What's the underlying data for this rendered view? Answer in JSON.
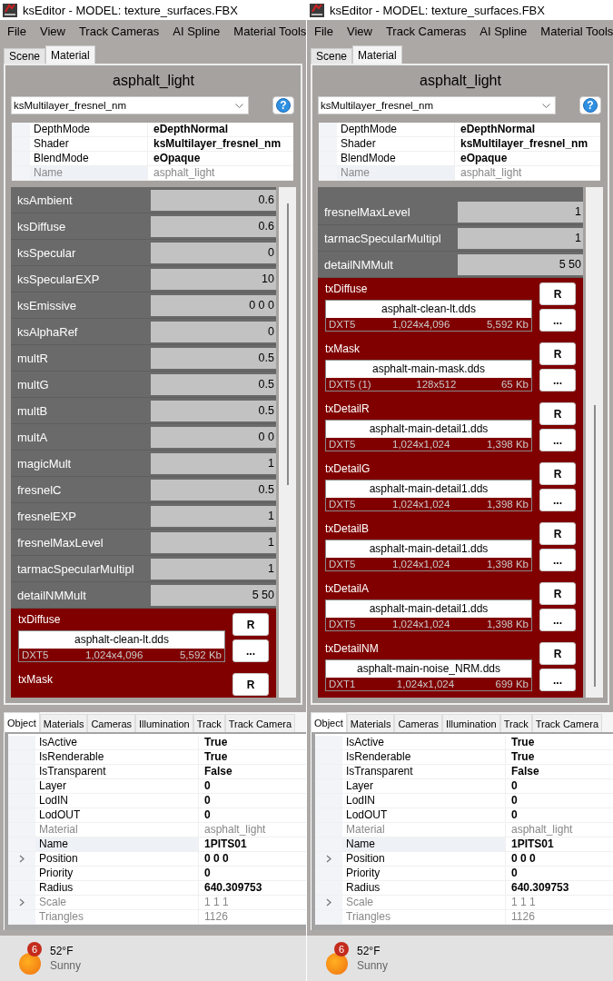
{
  "panels": [
    {
      "window": {
        "title": "ksEditor - MODEL: texture_surfaces.FBX"
      },
      "menu": [
        "File",
        "View",
        "Track Cameras",
        "AI Spline",
        "Material Tools"
      ],
      "tabs": [
        {
          "label": "Scene",
          "selected": false
        },
        {
          "label": "Material",
          "selected": true
        }
      ],
      "material": {
        "name": "asphalt_light",
        "shader_dropdown": {
          "value": "ksMultilayer_fresnel_nm"
        },
        "help_button": {
          "label": "?"
        },
        "properties": [
          {
            "label": "DepthMode",
            "value": "eDepthNormal",
            "readonly": false,
            "selected": false
          },
          {
            "label": "Shader",
            "value": "ksMultilayer_fresnel_nm",
            "readonly": false,
            "selected": false
          },
          {
            "label": "BlendMode",
            "value": "eOpaque",
            "readonly": false,
            "selected": false
          },
          {
            "label": "Name",
            "value": "asphalt_light",
            "readonly": true,
            "selected": true
          }
        ],
        "parameters": [
          {
            "label": "ksAmbient",
            "value": "0.6"
          },
          {
            "label": "ksDiffuse",
            "value": "0.6"
          },
          {
            "label": "ksSpecular",
            "value": "0"
          },
          {
            "label": "ksSpecularEXP",
            "value": "10"
          },
          {
            "label": "ksEmissive",
            "value": "0 0 0"
          },
          {
            "label": "ksAlphaRef",
            "value": "0"
          },
          {
            "label": "multR",
            "value": "0.5"
          },
          {
            "label": "multG",
            "value": "0.5"
          },
          {
            "label": "multB",
            "value": "0.5"
          },
          {
            "label": "multA",
            "value": "0 0"
          },
          {
            "label": "magicMult",
            "value": "1"
          },
          {
            "label": "fresnelC",
            "value": "0.5"
          },
          {
            "label": "fresnelEXP",
            "value": "1"
          },
          {
            "label": "fresnelMaxLevel",
            "value": "1"
          },
          {
            "label": "tarmacSpecularMultipl",
            "value": "1"
          },
          {
            "label": "detailNMMult",
            "value": "5 50"
          }
        ],
        "textures": [
          {
            "label": "txDiffuse",
            "file": "asphalt-clean-lt.dds",
            "format": "DXT5",
            "dimensions": "1,024x4,096",
            "filesize": "5,592 Kb",
            "buttons": [
              "R",
              "..."
            ]
          },
          {
            "label": "txMask",
            "buttons": [
              "R"
            ]
          }
        ]
      },
      "object_tabs": [
        {
          "label": "Object",
          "selected": true
        },
        {
          "label": "Materials",
          "selected": false
        },
        {
          "label": "Cameras",
          "selected": false
        },
        {
          "label": "Illumination",
          "selected": false
        },
        {
          "label": "Track",
          "selected": false
        },
        {
          "label": "Track Camera",
          "selected": false
        }
      ],
      "object_properties": [
        {
          "label": "IsActive",
          "value": "True",
          "readonly": false,
          "expandable": false,
          "selected": false
        },
        {
          "label": "IsRenderable",
          "value": "True",
          "readonly": false,
          "expandable": false,
          "selected": false
        },
        {
          "label": "IsTransparent",
          "value": "False",
          "readonly": false,
          "expandable": false,
          "selected": false
        },
        {
          "label": "Layer",
          "value": "0",
          "readonly": false,
          "expandable": false,
          "selected": false
        },
        {
          "label": "LodIN",
          "value": "0",
          "readonly": false,
          "expandable": false,
          "selected": false
        },
        {
          "label": "LodOUT",
          "value": "0",
          "readonly": false,
          "expandable": false,
          "selected": false
        },
        {
          "label": "Material",
          "value": "asphalt_light",
          "readonly": true,
          "expandable": false,
          "selected": false
        },
        {
          "label": "Name",
          "value": "1PITS01",
          "readonly": false,
          "expandable": false,
          "selected": true
        },
        {
          "label": "Position",
          "value": "0 0 0",
          "readonly": false,
          "expandable": true,
          "selected": false
        },
        {
          "label": "Priority",
          "value": "0",
          "readonly": false,
          "expandable": false,
          "selected": false
        },
        {
          "label": "Radius",
          "value": "640.309753",
          "readonly": false,
          "expandable": false,
          "selected": false
        },
        {
          "label": "Scale",
          "value": "1 1 1",
          "readonly": true,
          "expandable": true,
          "selected": false
        },
        {
          "label": "Triangles",
          "value": "1126",
          "readonly": true,
          "expandable": false,
          "selected": false
        }
      ],
      "taskbar": {
        "weather": {
          "badge": "6",
          "temperature": "52°F",
          "condition": "Sunny"
        }
      }
    },
    {
      "window": {
        "title": "ksEditor - MODEL: texture_surfaces.FBX"
      },
      "menu": [
        "File",
        "View",
        "Track Cameras",
        "AI Spline",
        "Material Tools"
      ],
      "tabs": [
        {
          "label": "Scene",
          "selected": false
        },
        {
          "label": "Material",
          "selected": true
        }
      ],
      "material": {
        "name": "asphalt_light",
        "shader_dropdown": {
          "value": "ksMultilayer_fresnel_nm"
        },
        "help_button": {
          "label": "?"
        },
        "properties": [
          {
            "label": "DepthMode",
            "value": "eDepthNormal",
            "readonly": false,
            "selected": false
          },
          {
            "label": "Shader",
            "value": "ksMultilayer_fresnel_nm",
            "readonly": false,
            "selected": false
          },
          {
            "label": "BlendMode",
            "value": "eOpaque",
            "readonly": false,
            "selected": false
          },
          {
            "label": "Name",
            "value": "asphalt_light",
            "readonly": true,
            "selected": true
          }
        ],
        "parameters": [
          {
            "label": "fresnelMaxLevel",
            "value": "1"
          },
          {
            "label": "tarmacSpecularMultipl",
            "value": "1"
          },
          {
            "label": "detailNMMult",
            "value": "5 50"
          }
        ],
        "textures": [
          {
            "label": "txDiffuse",
            "file": "asphalt-clean-lt.dds",
            "format": "DXT5",
            "dimensions": "1,024x4,096",
            "filesize": "5,592 Kb",
            "buttons": [
              "R",
              "..."
            ]
          },
          {
            "label": "txMask",
            "file": "asphalt-main-mask.dds",
            "format": "DXT5 (1)",
            "dimensions": "128x512",
            "filesize": "65 Kb",
            "buttons": [
              "R",
              "..."
            ]
          },
          {
            "label": "txDetailR",
            "file": "asphalt-main-detail1.dds",
            "format": "DXT5",
            "dimensions": "1,024x1,024",
            "filesize": "1,398 Kb",
            "buttons": [
              "R",
              "..."
            ]
          },
          {
            "label": "txDetailG",
            "file": "asphalt-main-detail1.dds",
            "format": "DXT5",
            "dimensions": "1,024x1,024",
            "filesize": "1,398 Kb",
            "buttons": [
              "R",
              "..."
            ]
          },
          {
            "label": "txDetailB",
            "file": "asphalt-main-detail1.dds",
            "format": "DXT5",
            "dimensions": "1,024x1,024",
            "filesize": "1,398 Kb",
            "buttons": [
              "R",
              "..."
            ]
          },
          {
            "label": "txDetailA",
            "file": "asphalt-main-detail1.dds",
            "format": "DXT5",
            "dimensions": "1,024x1,024",
            "filesize": "1,398 Kb",
            "buttons": [
              "R",
              "..."
            ]
          },
          {
            "label": "txDetailNM",
            "file": "asphalt-main-noise_NRM.dds",
            "format": "DXT1",
            "dimensions": "1,024x1,024",
            "filesize": "699 Kb",
            "buttons": [
              "R",
              "..."
            ]
          }
        ]
      },
      "object_tabs": [
        {
          "label": "Object",
          "selected": true
        },
        {
          "label": "Materials",
          "selected": false
        },
        {
          "label": "Cameras",
          "selected": false
        },
        {
          "label": "Illumination",
          "selected": false
        },
        {
          "label": "Track",
          "selected": false
        },
        {
          "label": "Track Camera",
          "selected": false
        }
      ],
      "object_properties": [
        {
          "label": "IsActive",
          "value": "True",
          "readonly": false,
          "expandable": false,
          "selected": false
        },
        {
          "label": "IsRenderable",
          "value": "True",
          "readonly": false,
          "expandable": false,
          "selected": false
        },
        {
          "label": "IsTransparent",
          "value": "False",
          "readonly": false,
          "expandable": false,
          "selected": false
        },
        {
          "label": "Layer",
          "value": "0",
          "readonly": false,
          "expandable": false,
          "selected": false
        },
        {
          "label": "LodIN",
          "value": "0",
          "readonly": false,
          "expandable": false,
          "selected": false
        },
        {
          "label": "LodOUT",
          "value": "0",
          "readonly": false,
          "expandable": false,
          "selected": false
        },
        {
          "label": "Material",
          "value": "asphalt_light",
          "readonly": true,
          "expandable": false,
          "selected": false
        },
        {
          "label": "Name",
          "value": "1PITS01",
          "readonly": false,
          "expandable": false,
          "selected": true
        },
        {
          "label": "Position",
          "value": "0 0 0",
          "readonly": false,
          "expandable": true,
          "selected": false
        },
        {
          "label": "Priority",
          "value": "0",
          "readonly": false,
          "expandable": false,
          "selected": false
        },
        {
          "label": "Radius",
          "value": "640.309753",
          "readonly": false,
          "expandable": false,
          "selected": false
        },
        {
          "label": "Scale",
          "value": "1 1 1",
          "readonly": true,
          "expandable": true,
          "selected": false
        },
        {
          "label": "Triangles",
          "value": "1126",
          "readonly": true,
          "expandable": false,
          "selected": false
        }
      ],
      "taskbar": {
        "weather": {
          "badge": "6",
          "temperature": "52°F",
          "condition": "Sunny"
        }
      }
    }
  ]
}
